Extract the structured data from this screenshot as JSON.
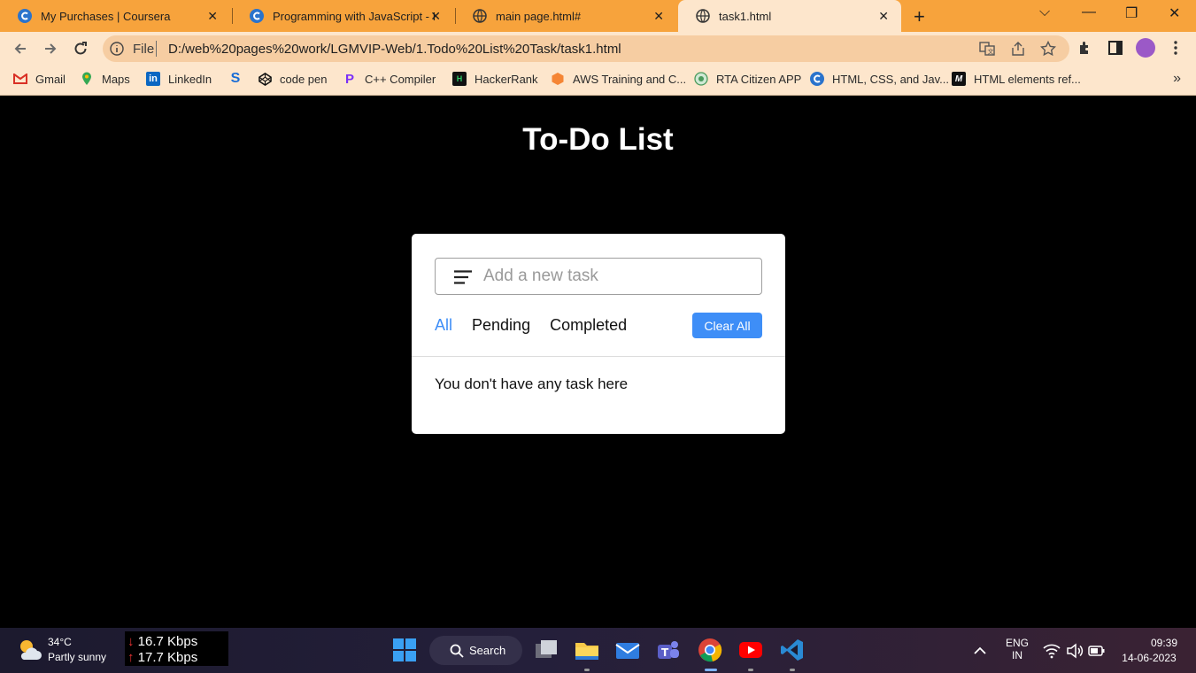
{
  "browser": {
    "tabs": [
      {
        "title": "My Purchases | Coursera",
        "active": false
      },
      {
        "title": "Programming with JavaScript - In",
        "active": false
      },
      {
        "title": "main page.html#",
        "active": false
      },
      {
        "title": "task1.html",
        "active": true
      }
    ],
    "address": {
      "scheme": "File",
      "url": "D:/web%20pages%20work/LGMVIP-Web/1.Todo%20List%20Task/task1.html"
    },
    "bookmarks": [
      {
        "label": "Gmail",
        "icon": "gmail-icon"
      },
      {
        "label": "Maps",
        "icon": "maps-icon"
      },
      {
        "label": "LinkedIn",
        "icon": "linkedin-icon"
      },
      {
        "label": "",
        "icon": "s-icon"
      },
      {
        "label": "code pen",
        "icon": "codepen-icon"
      },
      {
        "label": "C++ Compiler",
        "icon": "compiler-icon"
      },
      {
        "label": "HackerRank",
        "icon": "hackerrank-icon"
      },
      {
        "label": "AWS Training and C...",
        "icon": "aws-icon"
      },
      {
        "label": "RTA Citizen APP",
        "icon": "rta-icon"
      },
      {
        "label": "HTML, CSS, and Jav...",
        "icon": "coursera-icon"
      },
      {
        "label": "HTML elements ref...",
        "icon": "mdn-icon"
      }
    ],
    "more_bookmarks": "»"
  },
  "todo": {
    "heading": "To-Do List",
    "input_placeholder": "Add a new task",
    "filters": [
      "All",
      "Pending",
      "Completed"
    ],
    "active_filter": "All",
    "clear_label": "Clear All",
    "empty_message": "You don't have any task here"
  },
  "taskbar": {
    "weather": {
      "temp": "34°C",
      "desc": "Partly sunny"
    },
    "net": {
      "down": "16.7 Kbps",
      "up": "17.7 Kbps",
      "down_arrow": "↓",
      "up_arrow": "↑"
    },
    "search_label": "Search",
    "lang": {
      "line1": "ENG",
      "line2": "IN"
    },
    "time": "09:39",
    "date": "14-06-2023",
    "apps": [
      "windows-start-icon",
      "search-icon",
      "task-view-icon",
      "file-explorer-icon",
      "mail-icon",
      "teams-icon",
      "chrome-icon",
      "youtube-icon",
      "vscode-icon"
    ]
  },
  "colors": {
    "accent": "#3e8ef7",
    "tabstrip": "#f7a33c",
    "toolbar": "#fde6cc",
    "page_bg": "#000000"
  }
}
